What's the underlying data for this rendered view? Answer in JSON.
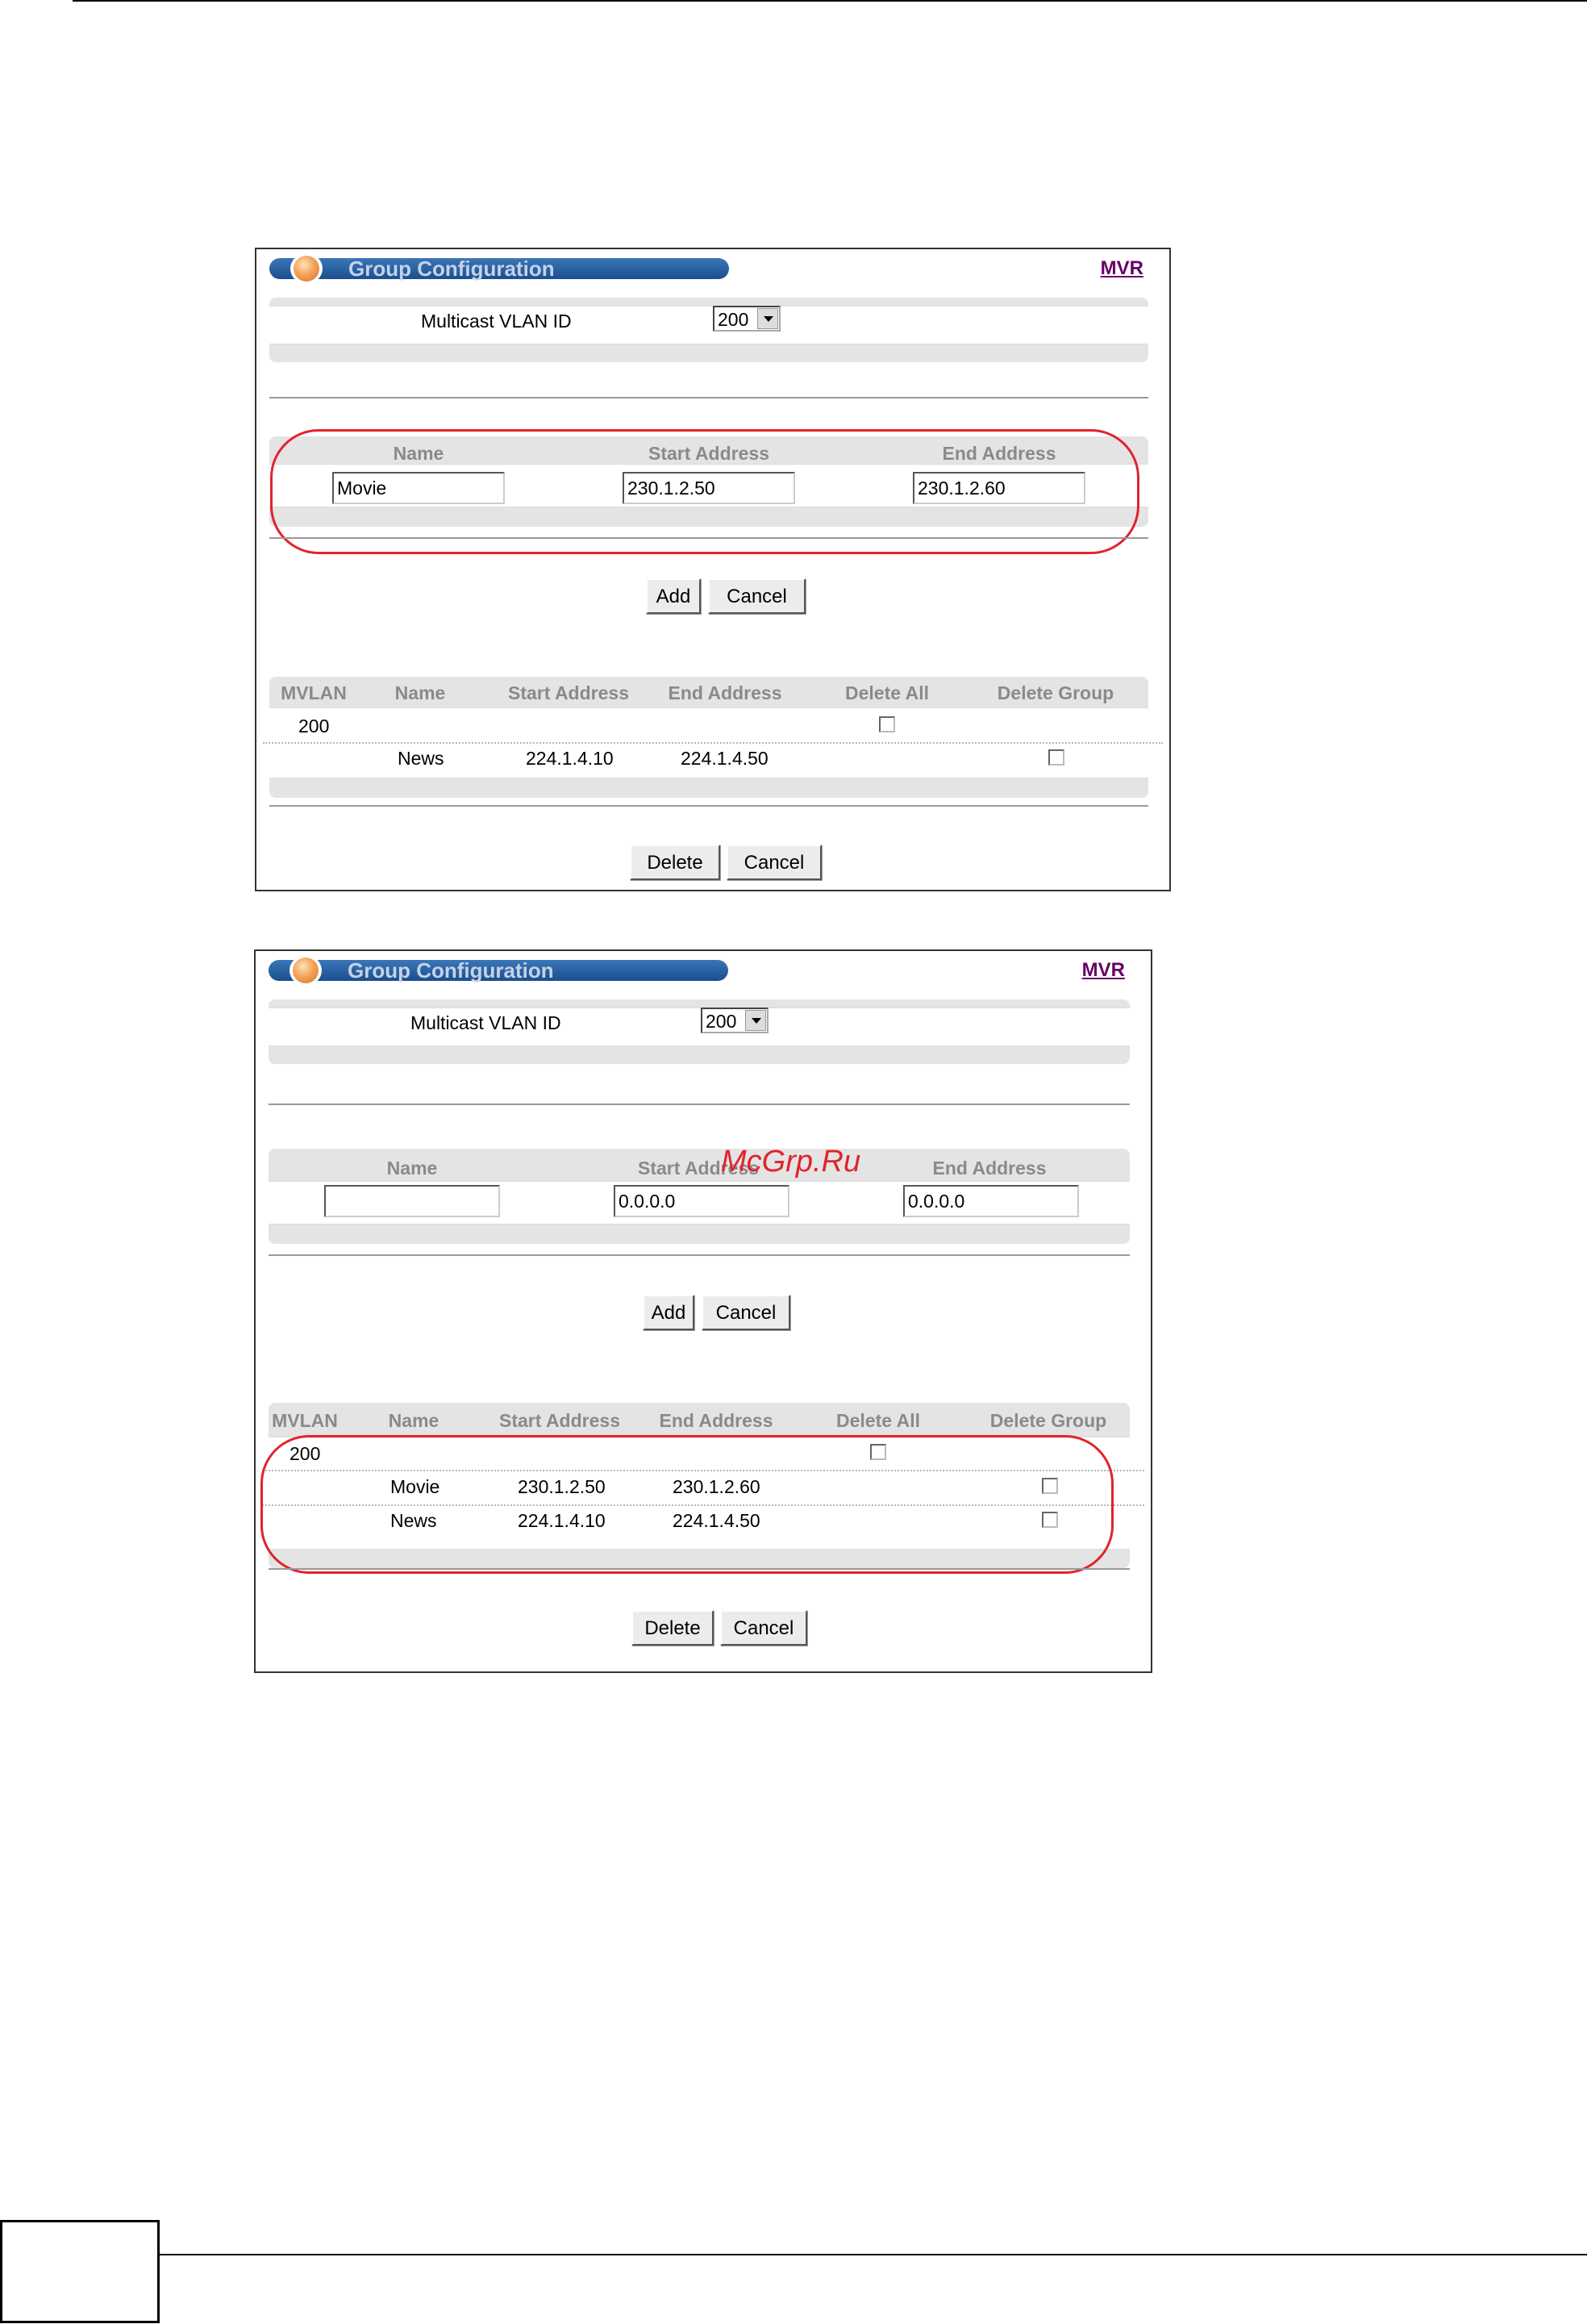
{
  "panels": [
    {
      "title": "Group Configuration",
      "link": "MVR",
      "vlan_label": "Multicast VLAN ID",
      "vlan_value": "200",
      "columns": {
        "name": "Name",
        "start": "Start Address",
        "end": "End Address"
      },
      "inputs": {
        "name": "Movie",
        "start": "230.1.2.50",
        "end": "230.1.2.60"
      },
      "add_label": "Add",
      "cancel_label": "Cancel",
      "table": {
        "headers": [
          "MVLAN",
          "Name",
          "Start Address",
          "End Address",
          "Delete All",
          "Delete Group"
        ],
        "mvlan": "200",
        "rows": [
          {
            "name": "News",
            "start": "224.1.4.10",
            "end": "224.1.4.50"
          }
        ]
      },
      "delete_label": "Delete",
      "cancel2_label": "Cancel"
    },
    {
      "title": "Group Configuration",
      "link": "MVR",
      "vlan_label": "Multicast VLAN ID",
      "vlan_value": "200",
      "columns": {
        "name": "Name",
        "start": "Start Address",
        "end": "End Address"
      },
      "inputs": {
        "name": "",
        "start": "0.0.0.0",
        "end": "0.0.0.0"
      },
      "add_label": "Add",
      "cancel_label": "Cancel",
      "table": {
        "headers": [
          "MVLAN",
          "Name",
          "Start Address",
          "End Address",
          "Delete All",
          "Delete Group"
        ],
        "mvlan": "200",
        "rows": [
          {
            "name": "Movie",
            "start": "230.1.2.50",
            "end": "230.1.2.60"
          },
          {
            "name": "News",
            "start": "224.1.4.10",
            "end": "224.1.4.50"
          }
        ]
      },
      "delete_label": "Delete",
      "cancel2_label": "Cancel"
    }
  ],
  "watermark": "McGrp.Ru",
  "colors": {
    "highlight": "#e0242c",
    "link": "#660066",
    "title_bar": "#1b4f8e"
  }
}
